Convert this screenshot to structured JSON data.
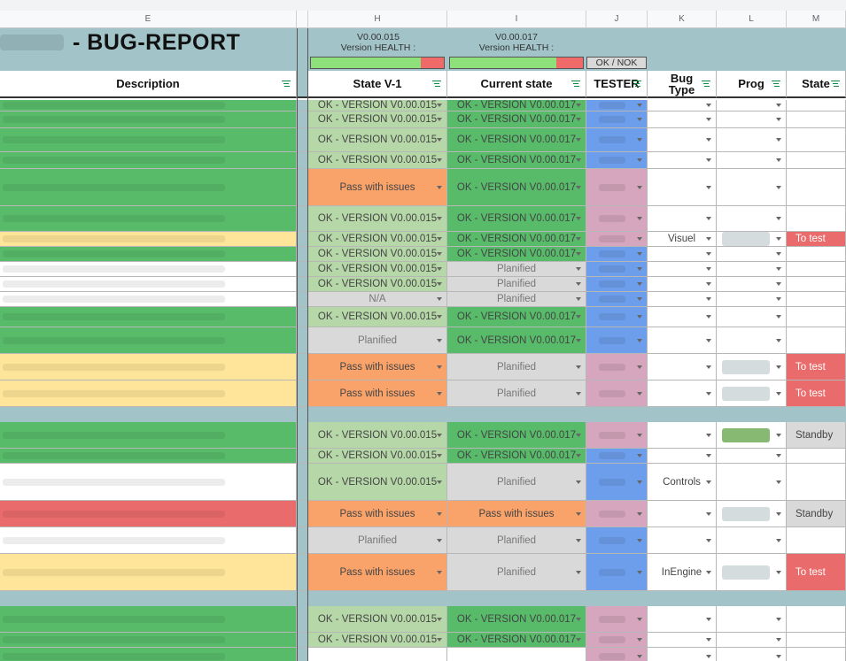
{
  "columns": [
    "E",
    "",
    "H",
    "I",
    "J",
    "K",
    "L",
    "M"
  ],
  "title": "- BUG-REPORT",
  "versions": [
    {
      "number": "V0.00.015",
      "label": "Version HEALTH :"
    },
    {
      "number": "V0.00.017",
      "label": "Version HEALTH :"
    }
  ],
  "oknok": "OK / NOK",
  "headers": {
    "description": "Description",
    "state_v1": "State V-1",
    "current_state": "Current state",
    "tester": "TESTER",
    "bug_type": "Bug Type",
    "prog": "Prog",
    "state": "State"
  },
  "colors": {
    "green_light": "#b6d7a8",
    "green": "#57bb6a",
    "orange": "#f9a36b",
    "gray": "#d9d9d9",
    "blue": "#6d9eeb",
    "pink": "#d5a6bd",
    "yellow": "#ffe599",
    "red": "#ea6b6b",
    "teal": "#a2c4c9"
  },
  "rows": [
    {
      "desc": "green",
      "v1": "OK - VERSION V0.00.015",
      "cur": "OK - VERSION V0.00.017",
      "tester": "blue",
      "bug": "",
      "prog": "",
      "state": ""
    },
    {
      "desc": "green",
      "v1": "OK - VERSION V0.00.015",
      "cur": "OK - VERSION V0.00.017",
      "tester": "blue",
      "bug": "",
      "prog": "",
      "state": ""
    },
    {
      "desc": "green",
      "v1": "OK - VERSION V0.00.015",
      "cur": "OK - VERSION V0.00.017",
      "tester": "blue",
      "bug": "",
      "prog": "",
      "state": ""
    },
    {
      "desc": "green",
      "v1": "OK - VERSION V0.00.015",
      "cur": "OK - VERSION V0.00.017",
      "tester": "blue",
      "bug": "",
      "prog": "",
      "state": ""
    },
    {
      "desc": "green",
      "v1": "Pass with issues",
      "cur": "OK - VERSION V0.00.017",
      "tester": "pink",
      "bug": "",
      "prog": "",
      "state": ""
    },
    {
      "desc": "green",
      "v1": "OK - VERSION V0.00.015",
      "cur": "OK - VERSION V0.00.017",
      "tester": "pink",
      "bug": "",
      "prog": "",
      "state": ""
    },
    {
      "desc": "yellow",
      "v1": "OK - VERSION V0.00.015",
      "cur": "OK - VERSION V0.00.017",
      "tester": "pink",
      "bug": "Visuel",
      "prog": "blur",
      "state": "To test"
    },
    {
      "desc": "green",
      "v1": "OK - VERSION V0.00.015",
      "cur": "OK - VERSION V0.00.017",
      "tester": "blue",
      "bug": "",
      "prog": "",
      "state": ""
    },
    {
      "desc": "white",
      "v1": "OK - VERSION V0.00.015",
      "cur": "Planified",
      "tester": "blue",
      "bug": "",
      "prog": "",
      "state": ""
    },
    {
      "desc": "white",
      "v1": "OK - VERSION V0.00.015",
      "cur": "Planified",
      "tester": "blue",
      "bug": "",
      "prog": "",
      "state": ""
    },
    {
      "desc": "white",
      "v1": "N/A",
      "cur": "Planified",
      "tester": "blue",
      "bug": "",
      "prog": "",
      "state": ""
    },
    {
      "desc": "green",
      "v1": "OK - VERSION V0.00.015",
      "cur": "OK - VERSION V0.00.017",
      "tester": "blue",
      "bug": "",
      "prog": "",
      "state": ""
    },
    {
      "desc": "green",
      "v1": "Planified",
      "cur": "OK - VERSION V0.00.017",
      "tester": "blue",
      "bug": "",
      "prog": "",
      "state": ""
    },
    {
      "desc": "yellow",
      "v1": "Pass with issues",
      "cur": "Planified",
      "tester": "pink",
      "bug": "",
      "prog": "blur",
      "state": "To test"
    },
    {
      "desc": "yellow",
      "v1": "Pass with issues",
      "cur": "Planified",
      "tester": "pink",
      "bug": "",
      "prog": "blur",
      "state": "To test"
    },
    {
      "sep": true
    },
    {
      "desc": "green",
      "v1": "OK - VERSION V0.00.015",
      "cur": "OK - VERSION V0.00.017",
      "tester": "pink",
      "bug": "",
      "prog": "greenblur",
      "state": "Standby"
    },
    {
      "desc": "green",
      "v1": "OK - VERSION V0.00.015",
      "cur": "OK - VERSION V0.00.017",
      "tester": "blue",
      "bug": "",
      "prog": "",
      "state": ""
    },
    {
      "desc": "white",
      "v1": "OK - VERSION V0.00.015",
      "cur": "Planified",
      "tester": "blue",
      "bug": "Controls",
      "prog": "",
      "state": ""
    },
    {
      "desc": "red",
      "v1": "Pass with issues",
      "cur": "Pass with issues",
      "tester": "pink",
      "bug": "",
      "prog": "blur",
      "state": "Standby"
    },
    {
      "desc": "white",
      "v1": "Planified",
      "cur": "Planified",
      "tester": "blue",
      "bug": "",
      "prog": "",
      "state": ""
    },
    {
      "desc": "yellow",
      "v1": "Pass with issues",
      "cur": "Planified",
      "tester": "blue",
      "bug": "InEngine",
      "prog": "blur",
      "state": "To test"
    },
    {
      "sep": true
    },
    {
      "desc": "green",
      "v1": "OK - VERSION V0.00.015",
      "cur": "OK - VERSION V0.00.017",
      "tester": "pink",
      "bug": "",
      "prog": "",
      "state": ""
    },
    {
      "desc": "green",
      "v1": "OK - VERSION V0.00.015",
      "cur": "OK - VERSION V0.00.017",
      "tester": "pink",
      "bug": "",
      "prog": "",
      "state": ""
    },
    {
      "desc": "green",
      "v1": "",
      "cur": "",
      "tester": "pink",
      "bug": "",
      "prog": "",
      "state": ""
    }
  ]
}
